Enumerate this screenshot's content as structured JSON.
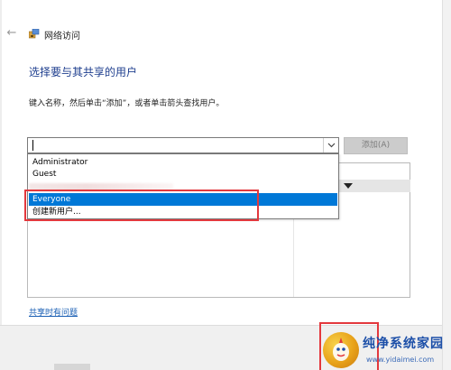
{
  "window": {
    "title": "网络访问"
  },
  "heading": "选择要与其共享的用户",
  "instruction": "键入名称，然后单击“添加”，或者单击箭头查找用户。",
  "combo": {
    "value": ""
  },
  "add_button": {
    "label": "添加(A)"
  },
  "dropdown": {
    "items": [
      {
        "label": "Administrator",
        "selected": false
      },
      {
        "label": "Guest",
        "selected": false
      },
      {
        "label": "Everyone",
        "selected": true
      },
      {
        "label": "创建新用户...",
        "selected": false
      }
    ]
  },
  "help_link": "共享时有问题",
  "watermark": {
    "brand": "纯净系统家园",
    "url": "www.yidaimei.com"
  },
  "colors": {
    "accent": "#0078d7",
    "heading": "#1f3f8f",
    "highlight": "#e3383d",
    "link": "#1a5fb4"
  }
}
